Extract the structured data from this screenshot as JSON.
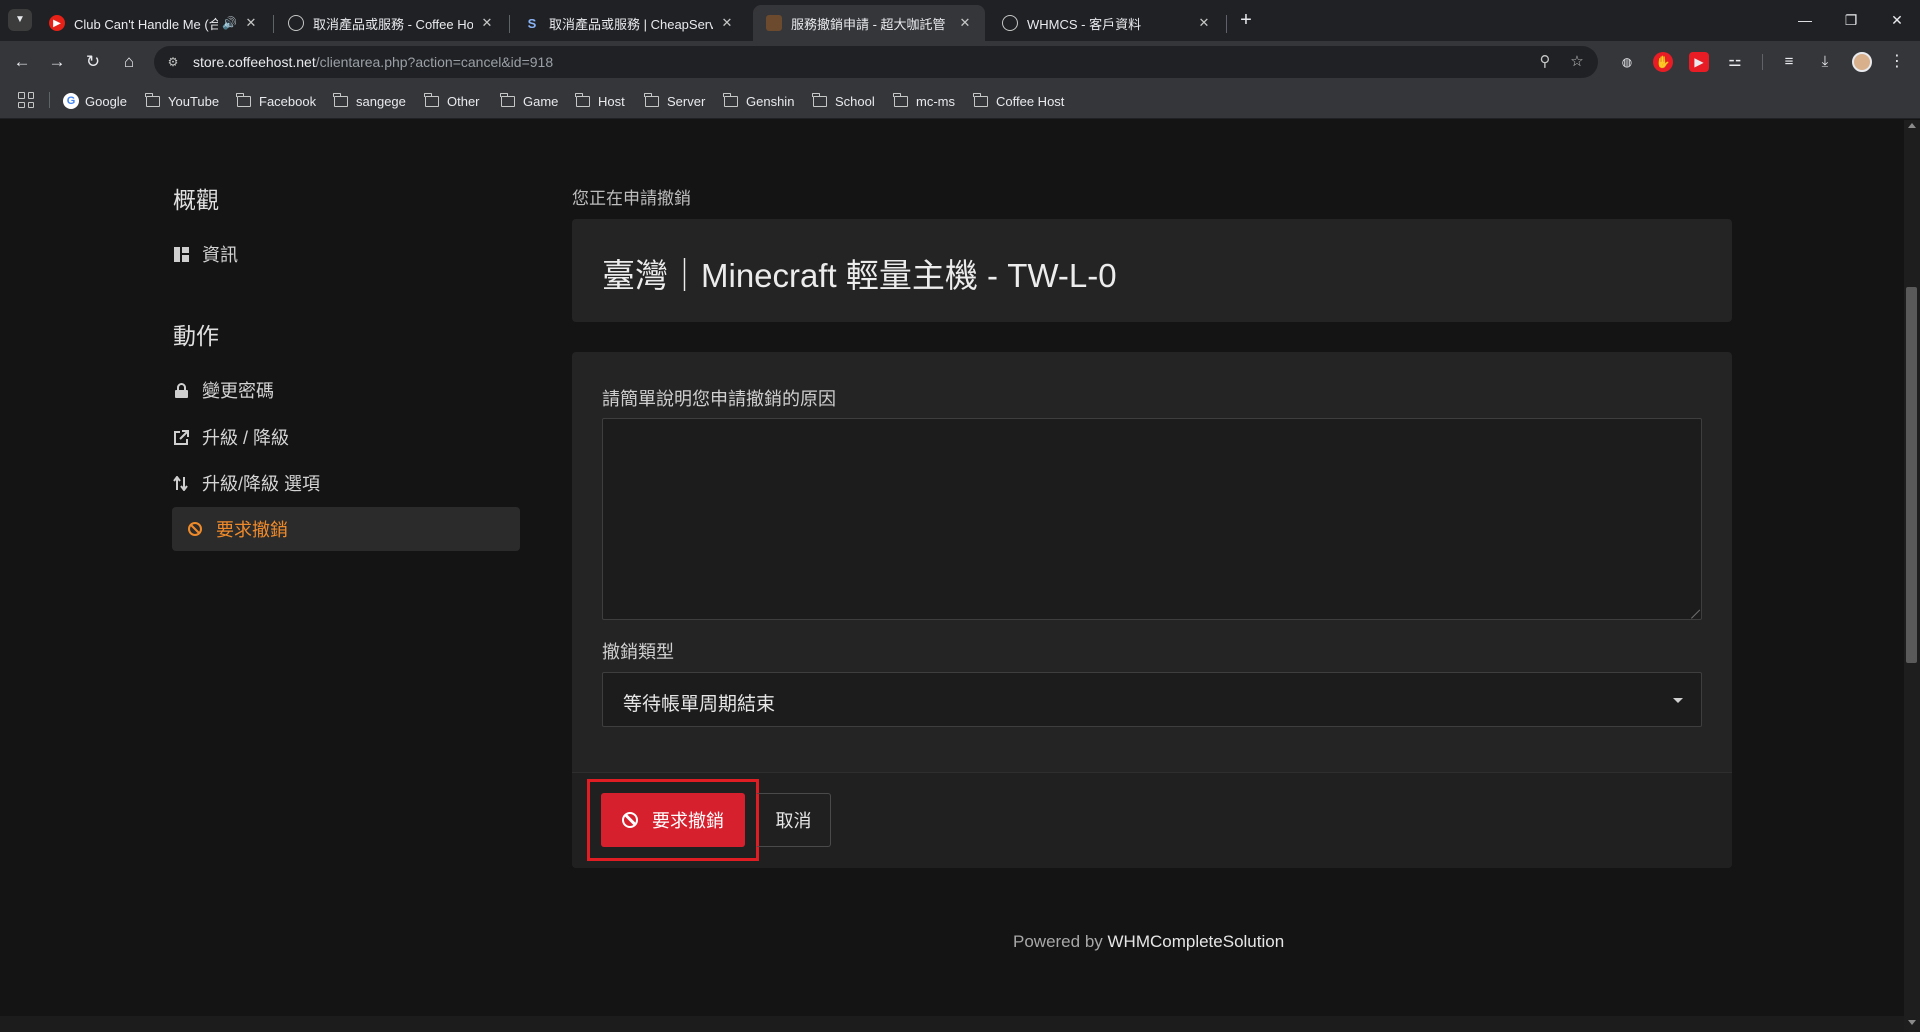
{
  "browser": {
    "tabs": [
      {
        "title": "Club Can't Handle Me (合",
        "favicon": "youtube-icon"
      },
      {
        "title": "取消產品或服務 - Coffee Host",
        "favicon": "globe-icon"
      },
      {
        "title": "取消產品或服務 | CheapServer",
        "favicon": "cheapserver-icon"
      },
      {
        "title": "服務撤銷申請 - 超大咖託管",
        "favicon": "coffeehost-icon"
      },
      {
        "title": "WHMCS - 客戶資料",
        "favicon": "globe-icon"
      }
    ],
    "active_tab_index": 3,
    "url": {
      "host": "store.coffeehost.net",
      "path": "/clientarea.php?action=cancel&id=918"
    },
    "bookmarks": [
      "Google",
      "YouTube",
      "Facebook",
      "sangege",
      "Other",
      "Game",
      "Host",
      "Server",
      "Genshin",
      "School",
      "mc-ms",
      "Coffee Host"
    ]
  },
  "sidebar": {
    "overview_heading": "概觀",
    "overview_items": [
      {
        "label": "資訊",
        "icon": "dashboard-icon"
      }
    ],
    "actions_heading": "動作",
    "action_items": [
      {
        "label": "變更密碼",
        "icon": "lock-icon"
      },
      {
        "label": "升級 / 降級",
        "icon": "external-link-icon"
      },
      {
        "label": "升級/降級 選項",
        "icon": "sort-arrows-icon"
      },
      {
        "label": "要求撤銷",
        "icon": "ban-icon",
        "active": true
      }
    ]
  },
  "main": {
    "intro": "您正在申請撤銷",
    "product_title": "臺灣｜Minecraft 輕量主機 - TW-L-0",
    "reason_label": "請簡單說明您申請撤銷的原因",
    "reason_value": "",
    "type_label": "撤銷類型",
    "type_value": "等待帳單周期結束",
    "submit_label": "要求撤銷",
    "cancel_label": "取消"
  },
  "footer": {
    "prefix": "Powered by ",
    "brand": "WHMCompleteSolution"
  },
  "colors": {
    "accent": "#ef8a2b",
    "danger": "#d7202e",
    "highlight": "#e11d24",
    "background": "#141414",
    "card": "#242424"
  }
}
